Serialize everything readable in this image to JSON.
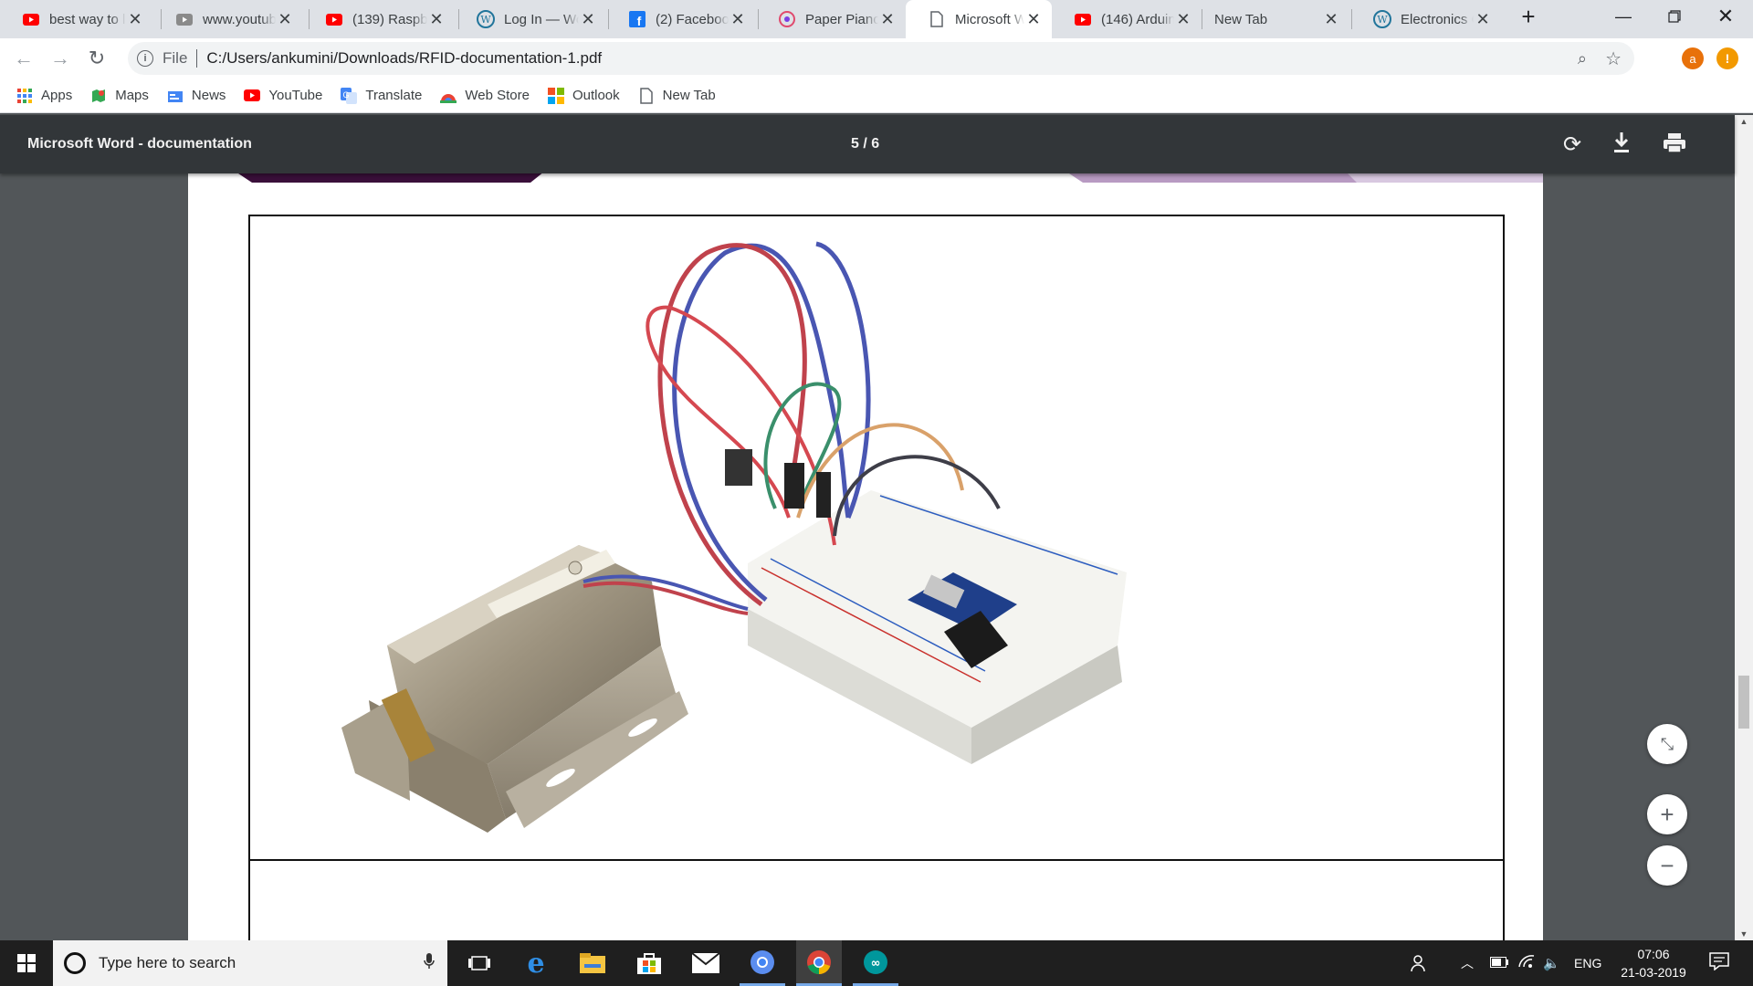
{
  "tabs": [
    {
      "title": "best way to l",
      "icon": "youtube-icon"
    },
    {
      "title": "www.youtub",
      "icon": "video-icon"
    },
    {
      "title": "(139) Raspbe",
      "icon": "youtube-icon"
    },
    {
      "title": "Log In — Wo",
      "icon": "wordpress-icon"
    },
    {
      "title": "(2) Facebook",
      "icon": "facebook-icon"
    },
    {
      "title": "Paper Piano",
      "icon": "piano-icon"
    },
    {
      "title": "Microsoft W",
      "icon": "document-icon"
    },
    {
      "title": "(146) Arduin",
      "icon": "youtube-icon"
    },
    {
      "title": "New Tab",
      "icon": ""
    },
    {
      "title": "Electronics C",
      "icon": "wordpress-icon"
    }
  ],
  "address": {
    "scheme": "File",
    "url": "C:/Users/ankumini/Downloads/RFID-documentation-1.pdf",
    "profile_initial": "a"
  },
  "bookmarks": [
    {
      "label": "Apps",
      "icon": "apps-grid-icon"
    },
    {
      "label": "Maps",
      "icon": "maps-icon"
    },
    {
      "label": "News",
      "icon": "news-icon"
    },
    {
      "label": "YouTube",
      "icon": "youtube-icon"
    },
    {
      "label": "Translate",
      "icon": "translate-icon"
    },
    {
      "label": "Web Store",
      "icon": "web-store-icon"
    },
    {
      "label": "Outlook",
      "icon": "outlook-icon"
    },
    {
      "label": "New Tab",
      "icon": "page-icon"
    }
  ],
  "pdf": {
    "title": "Microsoft Word - documentation",
    "page_indicator": "5 / 6"
  },
  "taskbar": {
    "search_placeholder": "Type here to search",
    "lang": "ENG",
    "time": "07:06",
    "date": "21-03-2019"
  },
  "colors": {
    "youtube": "#ff0000",
    "facebook": "#1877f2",
    "wordpress": "#21759b",
    "profile": "#e8710a",
    "toolbar": "#323639"
  }
}
